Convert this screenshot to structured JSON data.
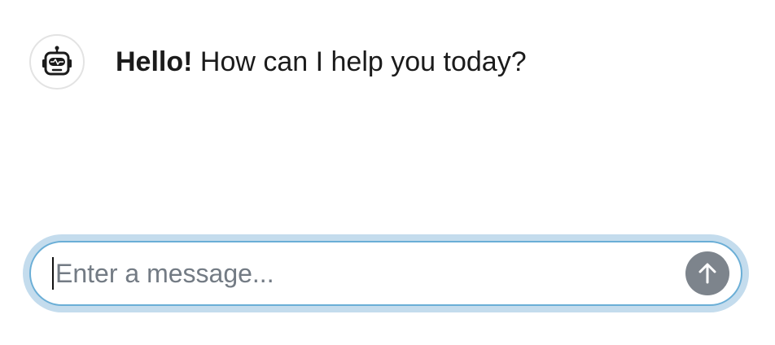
{
  "conversation": {
    "messages": [
      {
        "sender": "bot",
        "avatar_icon": "robot-icon",
        "greeting": "Hello!",
        "text": "How can I help you today?"
      }
    ]
  },
  "composer": {
    "placeholder": "Enter a message...",
    "value": "",
    "send_icon": "arrow-up-icon",
    "accent_color": "#6aaed6",
    "focus_ring_color": "#c4dced",
    "send_button_color": "#7d848c"
  }
}
